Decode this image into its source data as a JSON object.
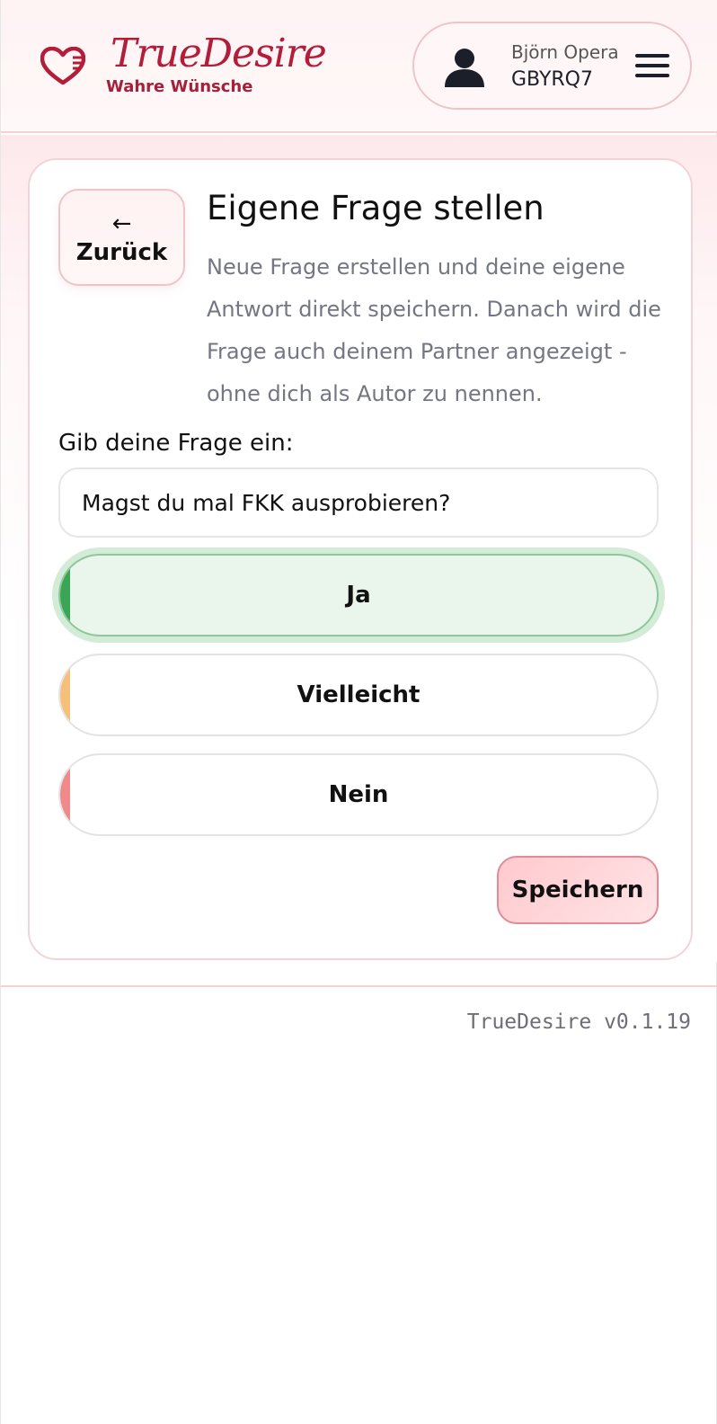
{
  "header": {
    "brand_name": "TrueDesire",
    "brand_tagline": "Wahre Wünsche",
    "user_name": "Björn Opera",
    "user_code": "GBYRQ7",
    "icons": {
      "brand": "heart-zipper-icon",
      "avatar": "user-icon",
      "menu": "hamburger-menu-icon"
    }
  },
  "card": {
    "back_arrow": "←",
    "back_label": "Zurück",
    "title": "Eigene Frage stellen",
    "description": "Neue Frage erstellen und deine eigene Antwort direkt speichern. Danach wird die Frage auch deinem Partner angezeigt - ohne dich als Autor zu nennen.",
    "field_label": "Gib deine Frage ein:",
    "question_value": "Magst du mal FKK ausprobieren?",
    "answers": [
      {
        "label": "Ja",
        "accent_color": "#3aa655",
        "selected": true
      },
      {
        "label": "Vielleicht",
        "accent_color": "#f5c07a",
        "selected": false
      },
      {
        "label": "Nein",
        "accent_color": "#f08a8a",
        "selected": false
      }
    ],
    "save_label": "Speichern"
  },
  "footer": {
    "version": "TrueDesire v0.1.19"
  },
  "colors": {
    "brand": "#b21e3a",
    "selected_bg": "#eaf5ec",
    "save_bg": "#ffc9ce"
  }
}
